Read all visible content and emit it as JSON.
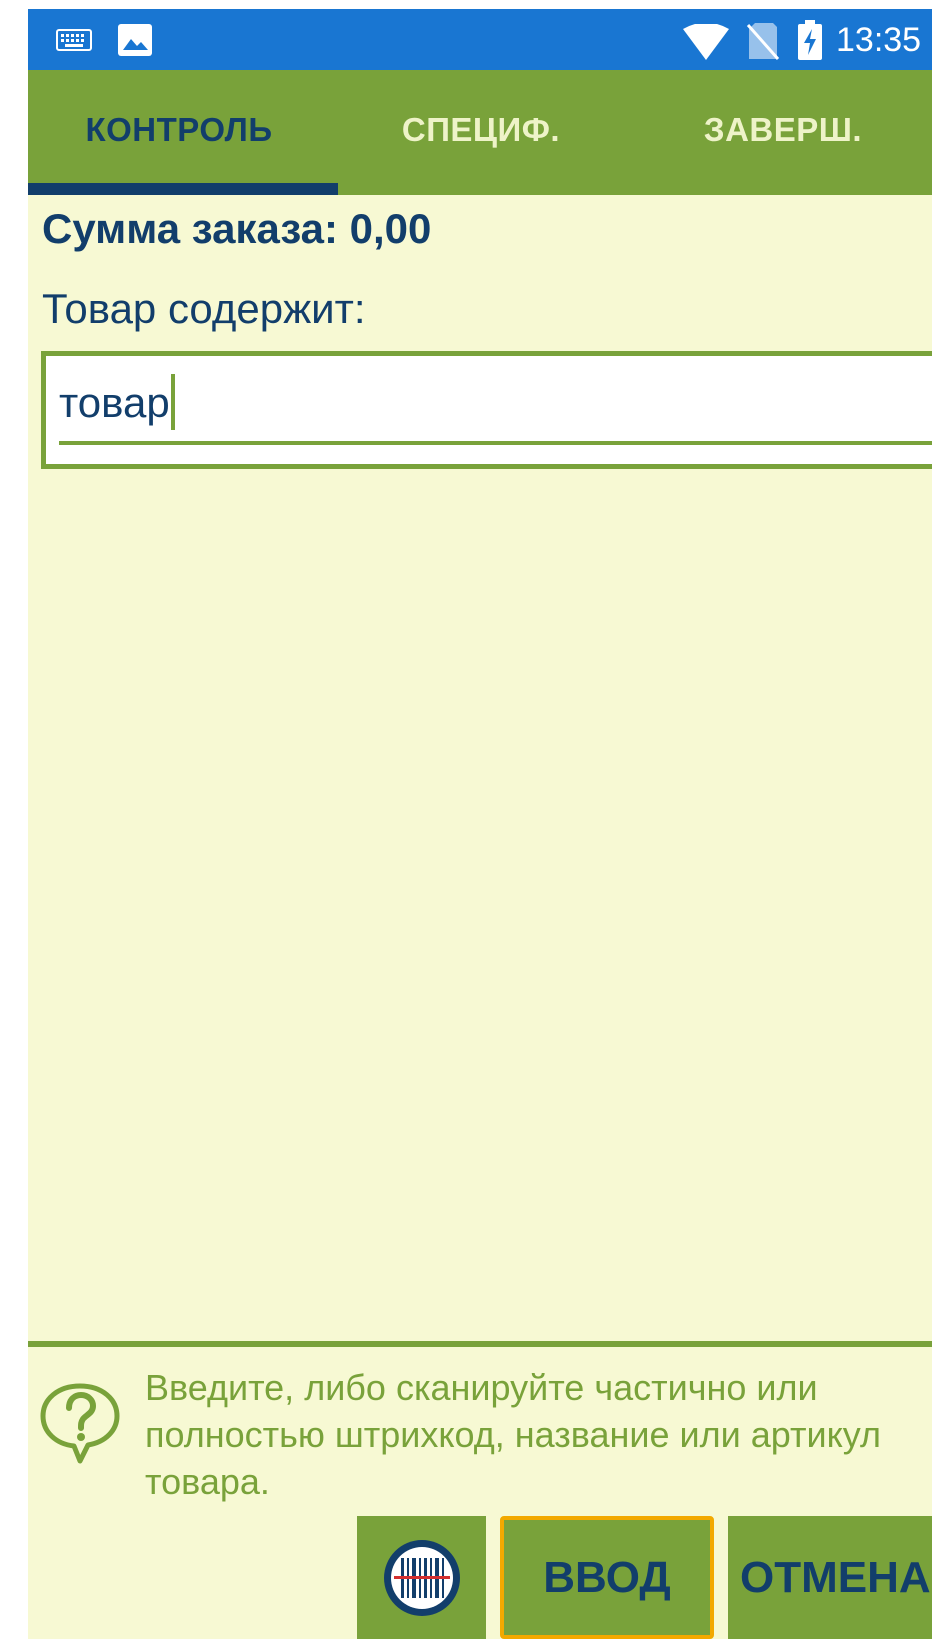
{
  "status_bar": {
    "time": "13:35",
    "icons": [
      "keyboard-icon",
      "image-icon",
      "wifi-icon",
      "no-sim-icon",
      "battery-charging-icon"
    ]
  },
  "tabs": [
    {
      "label": "КОНТРОЛЬ",
      "active": true
    },
    {
      "label": "СПЕЦИФ.",
      "active": false
    },
    {
      "label": "ЗАВЕРШ.",
      "active": false
    }
  ],
  "order_sum": "Сумма заказа: 0,00",
  "search": {
    "label": "Товар содержит:",
    "value": "товар"
  },
  "hint": "Введите, либо сканируйте частично или полностью штрихкод, название или артикул товара.",
  "buttons": {
    "scan_icon": "barcode-scan-icon",
    "enter_label": "ВВОД",
    "cancel_label": "ОТМЕНА"
  },
  "colors": {
    "status_bar": "#1976d2",
    "accent_green": "#79a23a",
    "background": "#f7f9d3",
    "text_navy": "#123e6b",
    "focus_border": "#f2a900"
  }
}
